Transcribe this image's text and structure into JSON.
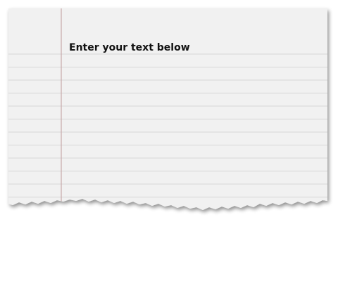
{
  "note_card": {
    "prompt": "Enter your text below",
    "text_value": "",
    "ruled": true,
    "margin_line": true,
    "torn_bottom_edge": true
  },
  "colors": {
    "page_background": "#ffffff",
    "paper": "#f1f1f1",
    "rule_line": "#d6d6d6",
    "margin_line": "#c9a9aa",
    "prompt_text": "#111111"
  }
}
